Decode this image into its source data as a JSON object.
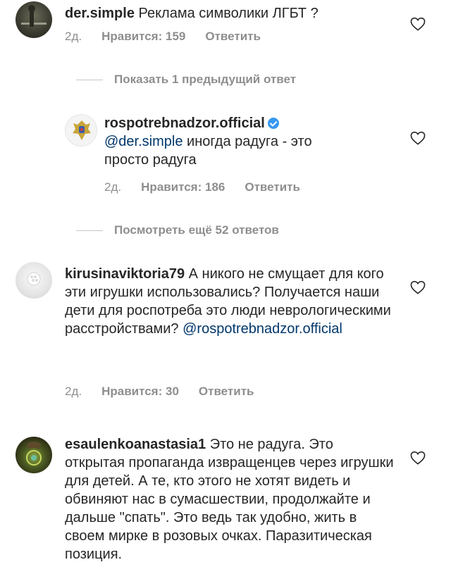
{
  "comments": [
    {
      "username": "der.simple",
      "text": "Реклама символики ЛГБТ ?",
      "time": "2д.",
      "likes": "Нравится: 159",
      "reply": "Ответить"
    },
    {
      "username": "rospotrebnadzor.official",
      "mention": "@der.simple",
      "text": "иногда радуга - это просто радуга",
      "time": "2д.",
      "likes": "Нравится: 186",
      "reply": "Ответить"
    },
    {
      "username": "kirusinaviktoria79",
      "text": "А никого не смущает для кого эти игрушки использовались? Получается наши дети для роспотреба это люди неврологическими расстройствами?",
      "mention": "@rospotrebnadzor.official",
      "time": "2д.",
      "likes": "Нравится: 30",
      "reply": "Ответить"
    },
    {
      "username": "esaulenkoanastasia1",
      "text": "Это не радуга. Это открытая пропаганда извращенцев через игрушки для детей. А те, кто этого не хотят видеть и обвиняют нас в сумасшествии, продолжайте и дальше \"спать\". Это ведь так удобно, жить в своем мирке в розовых очках. Паразитическая позиция."
    }
  ],
  "show_previous": "Показать 1 предыдущий ответ",
  "view_more": "Посмотреть ещё 52 ответов",
  "icons": {
    "like": "heart-outline-icon",
    "verified": "verified-badge-icon"
  },
  "colors": {
    "mention": "#00376b",
    "meta": "#8e8e8e",
    "verified": "#3897f0"
  }
}
